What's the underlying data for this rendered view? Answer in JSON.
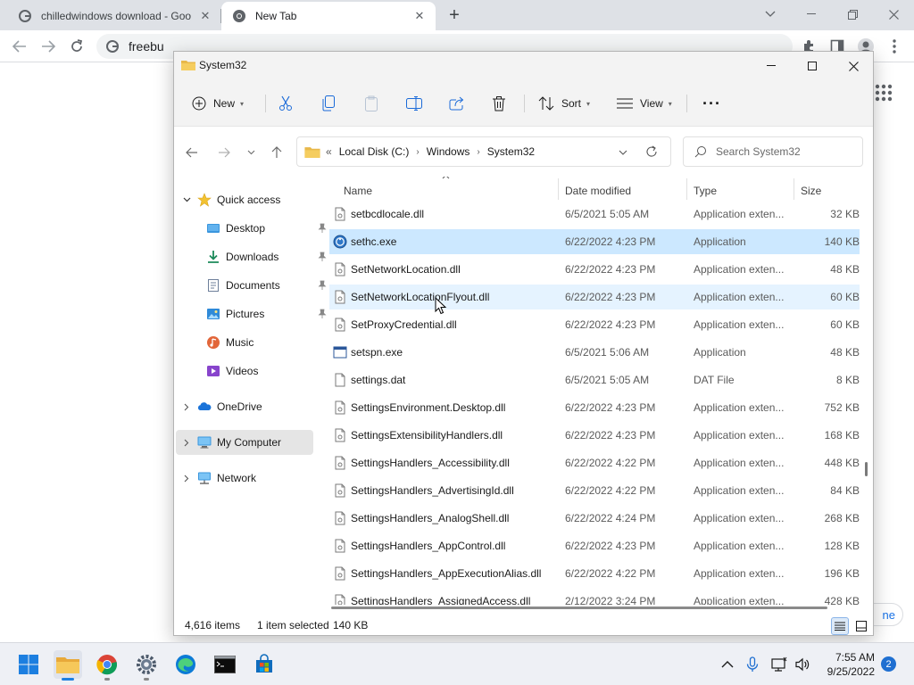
{
  "browser": {
    "tabs": [
      {
        "title": "chilledwindows download - Goo",
        "active": false
      },
      {
        "title": "New Tab",
        "active": true
      }
    ],
    "omnibox_text": "freebu",
    "page_partial_text": "ne"
  },
  "explorer": {
    "title": "System32",
    "commands": {
      "new_label": "New",
      "sort_label": "Sort",
      "view_label": "View",
      "more_label": "···"
    },
    "breadcrumb_prefix": "«",
    "breadcrumb": [
      "Local Disk (C:)",
      "Windows",
      "System32"
    ],
    "search_placeholder": "Search System32",
    "nav_pane": {
      "quick_access": "Quick access",
      "items": [
        {
          "label": "Desktop",
          "icon": "desktop-icon",
          "pinned": true
        },
        {
          "label": "Downloads",
          "icon": "downloads-icon",
          "pinned": true
        },
        {
          "label": "Documents",
          "icon": "documents-icon",
          "pinned": true
        },
        {
          "label": "Pictures",
          "icon": "pictures-icon",
          "pinned": true
        },
        {
          "label": "Music",
          "icon": "music-icon",
          "pinned": false
        },
        {
          "label": "Videos",
          "icon": "videos-icon",
          "pinned": false
        }
      ],
      "onedrive": "OneDrive",
      "my_computer": "My Computer",
      "network": "Network"
    },
    "columns": {
      "name": "Name",
      "date": "Date modified",
      "type": "Type",
      "size": "Size"
    },
    "files": [
      {
        "name": "setbcdlocale.dll",
        "date": "6/5/2021 5:05 AM",
        "type": "Application exten...",
        "size": "32 KB",
        "kind": "dll",
        "state": ""
      },
      {
        "name": "sethc.exe",
        "date": "6/22/2022 4:23 PM",
        "type": "Application",
        "size": "140 KB",
        "kind": "sethc",
        "state": "selected"
      },
      {
        "name": "SetNetworkLocation.dll",
        "date": "6/22/2022 4:23 PM",
        "type": "Application exten...",
        "size": "48 KB",
        "kind": "dll",
        "state": ""
      },
      {
        "name": "SetNetworkLocationFlyout.dll",
        "date": "6/22/2022 4:23 PM",
        "type": "Application exten...",
        "size": "60 KB",
        "kind": "dll",
        "state": "hover"
      },
      {
        "name": "SetProxyCredential.dll",
        "date": "6/22/2022 4:23 PM",
        "type": "Application exten...",
        "size": "60 KB",
        "kind": "dll",
        "state": ""
      },
      {
        "name": "setspn.exe",
        "date": "6/5/2021 5:06 AM",
        "type": "Application",
        "size": "48 KB",
        "kind": "exe",
        "state": ""
      },
      {
        "name": "settings.dat",
        "date": "6/5/2021 5:05 AM",
        "type": "DAT File",
        "size": "8 KB",
        "kind": "dat",
        "state": ""
      },
      {
        "name": "SettingsEnvironment.Desktop.dll",
        "date": "6/22/2022 4:23 PM",
        "type": "Application exten...",
        "size": "752 KB",
        "kind": "dll",
        "state": ""
      },
      {
        "name": "SettingsExtensibilityHandlers.dll",
        "date": "6/22/2022 4:23 PM",
        "type": "Application exten...",
        "size": "168 KB",
        "kind": "dll",
        "state": ""
      },
      {
        "name": "SettingsHandlers_Accessibility.dll",
        "date": "6/22/2022 4:22 PM",
        "type": "Application exten...",
        "size": "448 KB",
        "kind": "dll",
        "state": ""
      },
      {
        "name": "SettingsHandlers_AdvertisingId.dll",
        "date": "6/22/2022 4:22 PM",
        "type": "Application exten...",
        "size": "84 KB",
        "kind": "dll",
        "state": ""
      },
      {
        "name": "SettingsHandlers_AnalogShell.dll",
        "date": "6/22/2022 4:24 PM",
        "type": "Application exten...",
        "size": "268 KB",
        "kind": "dll",
        "state": ""
      },
      {
        "name": "SettingsHandlers_AppControl.dll",
        "date": "6/22/2022 4:23 PM",
        "type": "Application exten...",
        "size": "128 KB",
        "kind": "dll",
        "state": ""
      },
      {
        "name": "SettingsHandlers_AppExecutionAlias.dll",
        "date": "6/22/2022 4:22 PM",
        "type": "Application exten...",
        "size": "196 KB",
        "kind": "dll",
        "state": ""
      },
      {
        "name": "SettingsHandlers_AssignedAccess.dll",
        "date": "2/12/2022 3:24 PM",
        "type": "Application exten...",
        "size": "428 KB",
        "kind": "dll",
        "state": ""
      }
    ],
    "status": {
      "items": "4,616 items",
      "selected": "1 item selected",
      "size": "140 KB"
    }
  },
  "taskbar": {
    "apps": [
      "start-icon",
      "file-explorer-icon",
      "chrome-icon",
      "settings-icon",
      "edge-icon",
      "terminal-icon",
      "store-icon"
    ],
    "time": "7:55 AM",
    "date": "9/25/2022",
    "notifications": "2"
  },
  "colors": {
    "selection": "#cce8ff",
    "hover": "#e5f3ff",
    "accent": "#1f6fd1"
  }
}
